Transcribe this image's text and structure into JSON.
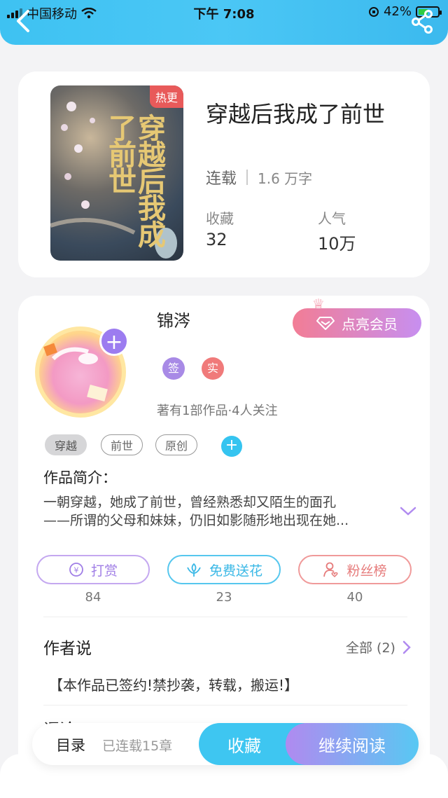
{
  "status_bar": {
    "carrier": "中国移动",
    "time": "下午 7:08",
    "battery": "42%"
  },
  "book": {
    "cover_badge": "热更",
    "cover_title_art": "穿越后我成了前世",
    "title": "穿越后我成了前世",
    "status": "连载",
    "word_count": "1.6 万字",
    "favorites_label": "收藏",
    "favorites_value": "32",
    "popularity_label": "人气",
    "popularity_value": "10万"
  },
  "author": {
    "name": "锦涔",
    "vip_button": "点亮会员",
    "badge_signed": "签",
    "badge_real": "实",
    "info": "著有1部作品·4人关注"
  },
  "tags": [
    "穿越",
    "前世",
    "原创"
  ],
  "intro": {
    "title": "作品简介：",
    "line1": "一朝穿越，她成了前世，曾经熟悉却又陌生的面孔",
    "line2": "——所谓的父母和妹妹，仍旧如影随形地出现在她..."
  },
  "actions": {
    "reward_label": "打赏",
    "reward_count": "84",
    "flower_label": "免费送花",
    "flower_count": "23",
    "fans_label": "粉丝榜",
    "fans_count": "40"
  },
  "author_says": {
    "title": "作者说",
    "all_label": "全部 (2)",
    "text": "【本作品已签约!禁抄袭，转载，搬运!】"
  },
  "comments": {
    "title": "评论"
  },
  "bottom": {
    "toc": "目录",
    "chapters": "已连载15章",
    "favorite": "收藏",
    "continue": "继续阅读"
  },
  "colors": {
    "header": "#3ec2f2",
    "accent_purple": "#b08af0",
    "accent_pink": "#f27d95",
    "accent_blue": "#3ec6f1"
  }
}
